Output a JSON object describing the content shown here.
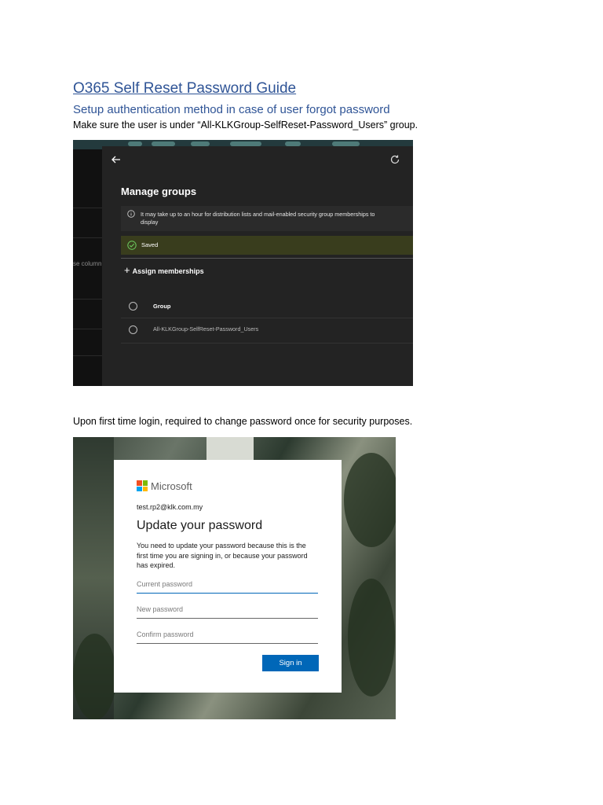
{
  "document": {
    "title": "O365 Self Reset Password Guide",
    "subtitle": "Setup authentication method in case of user forgot password",
    "note_group": "Make sure the user is under “All-KLKGroup-SelfReset-Password_Users” group.",
    "note_first_login": "Upon first time login, required to change password once for security purposes."
  },
  "manage_groups": {
    "left_pane_text": "se column",
    "title": "Manage groups",
    "info_message": "It may take up to an hour for distribution lists and mail-enabled security group memberships to display",
    "saved_message": "Saved",
    "assign_label": "Assign memberships",
    "column_header": "Group",
    "groups": [
      "All-KLKGroup-SelfReset-Password_Users"
    ]
  },
  "update_password": {
    "brand": "Microsoft",
    "email": "test.rp2@klk.com.my",
    "heading": "Update your password",
    "description": "You need to update your password because this is the first time you are signing in, or because your password has expired.",
    "current_placeholder": "Current password",
    "new_placeholder": "New password",
    "confirm_placeholder": "Confirm password",
    "signin_label": "Sign in"
  },
  "colors": {
    "heading_blue": "#2f5496",
    "ms_blue": "#0067b8",
    "logo_red": "#f25022",
    "logo_green": "#7fba00",
    "logo_blue": "#00a4ef",
    "logo_yellow": "#ffb900"
  }
}
